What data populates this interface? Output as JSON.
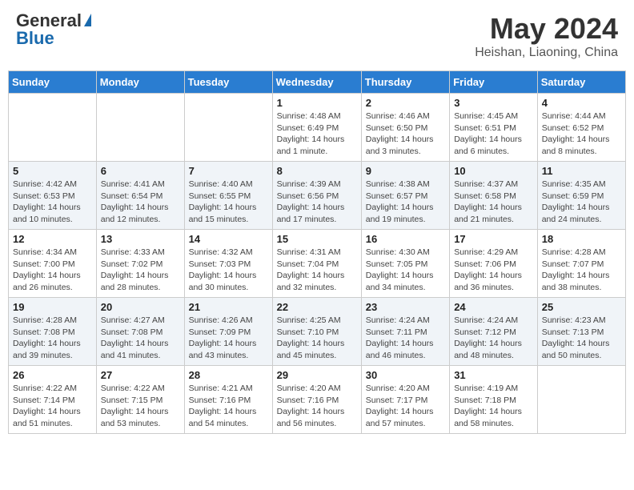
{
  "header": {
    "logo_general": "General",
    "logo_blue": "Blue",
    "title": "May 2024",
    "location": "Heishan, Liaoning, China"
  },
  "days_of_week": [
    "Sunday",
    "Monday",
    "Tuesday",
    "Wednesday",
    "Thursday",
    "Friday",
    "Saturday"
  ],
  "weeks": [
    [
      {
        "day": "",
        "detail": ""
      },
      {
        "day": "",
        "detail": ""
      },
      {
        "day": "",
        "detail": ""
      },
      {
        "day": "1",
        "detail": "Sunrise: 4:48 AM\nSunset: 6:49 PM\nDaylight: 14 hours\nand 1 minute."
      },
      {
        "day": "2",
        "detail": "Sunrise: 4:46 AM\nSunset: 6:50 PM\nDaylight: 14 hours\nand 3 minutes."
      },
      {
        "day": "3",
        "detail": "Sunrise: 4:45 AM\nSunset: 6:51 PM\nDaylight: 14 hours\nand 6 minutes."
      },
      {
        "day": "4",
        "detail": "Sunrise: 4:44 AM\nSunset: 6:52 PM\nDaylight: 14 hours\nand 8 minutes."
      }
    ],
    [
      {
        "day": "5",
        "detail": "Sunrise: 4:42 AM\nSunset: 6:53 PM\nDaylight: 14 hours\nand 10 minutes."
      },
      {
        "day": "6",
        "detail": "Sunrise: 4:41 AM\nSunset: 6:54 PM\nDaylight: 14 hours\nand 12 minutes."
      },
      {
        "day": "7",
        "detail": "Sunrise: 4:40 AM\nSunset: 6:55 PM\nDaylight: 14 hours\nand 15 minutes."
      },
      {
        "day": "8",
        "detail": "Sunrise: 4:39 AM\nSunset: 6:56 PM\nDaylight: 14 hours\nand 17 minutes."
      },
      {
        "day": "9",
        "detail": "Sunrise: 4:38 AM\nSunset: 6:57 PM\nDaylight: 14 hours\nand 19 minutes."
      },
      {
        "day": "10",
        "detail": "Sunrise: 4:37 AM\nSunset: 6:58 PM\nDaylight: 14 hours\nand 21 minutes."
      },
      {
        "day": "11",
        "detail": "Sunrise: 4:35 AM\nSunset: 6:59 PM\nDaylight: 14 hours\nand 24 minutes."
      }
    ],
    [
      {
        "day": "12",
        "detail": "Sunrise: 4:34 AM\nSunset: 7:00 PM\nDaylight: 14 hours\nand 26 minutes."
      },
      {
        "day": "13",
        "detail": "Sunrise: 4:33 AM\nSunset: 7:02 PM\nDaylight: 14 hours\nand 28 minutes."
      },
      {
        "day": "14",
        "detail": "Sunrise: 4:32 AM\nSunset: 7:03 PM\nDaylight: 14 hours\nand 30 minutes."
      },
      {
        "day": "15",
        "detail": "Sunrise: 4:31 AM\nSunset: 7:04 PM\nDaylight: 14 hours\nand 32 minutes."
      },
      {
        "day": "16",
        "detail": "Sunrise: 4:30 AM\nSunset: 7:05 PM\nDaylight: 14 hours\nand 34 minutes."
      },
      {
        "day": "17",
        "detail": "Sunrise: 4:29 AM\nSunset: 7:06 PM\nDaylight: 14 hours\nand 36 minutes."
      },
      {
        "day": "18",
        "detail": "Sunrise: 4:28 AM\nSunset: 7:07 PM\nDaylight: 14 hours\nand 38 minutes."
      }
    ],
    [
      {
        "day": "19",
        "detail": "Sunrise: 4:28 AM\nSunset: 7:08 PM\nDaylight: 14 hours\nand 39 minutes."
      },
      {
        "day": "20",
        "detail": "Sunrise: 4:27 AM\nSunset: 7:08 PM\nDaylight: 14 hours\nand 41 minutes."
      },
      {
        "day": "21",
        "detail": "Sunrise: 4:26 AM\nSunset: 7:09 PM\nDaylight: 14 hours\nand 43 minutes."
      },
      {
        "day": "22",
        "detail": "Sunrise: 4:25 AM\nSunset: 7:10 PM\nDaylight: 14 hours\nand 45 minutes."
      },
      {
        "day": "23",
        "detail": "Sunrise: 4:24 AM\nSunset: 7:11 PM\nDaylight: 14 hours\nand 46 minutes."
      },
      {
        "day": "24",
        "detail": "Sunrise: 4:24 AM\nSunset: 7:12 PM\nDaylight: 14 hours\nand 48 minutes."
      },
      {
        "day": "25",
        "detail": "Sunrise: 4:23 AM\nSunset: 7:13 PM\nDaylight: 14 hours\nand 50 minutes."
      }
    ],
    [
      {
        "day": "26",
        "detail": "Sunrise: 4:22 AM\nSunset: 7:14 PM\nDaylight: 14 hours\nand 51 minutes."
      },
      {
        "day": "27",
        "detail": "Sunrise: 4:22 AM\nSunset: 7:15 PM\nDaylight: 14 hours\nand 53 minutes."
      },
      {
        "day": "28",
        "detail": "Sunrise: 4:21 AM\nSunset: 7:16 PM\nDaylight: 14 hours\nand 54 minutes."
      },
      {
        "day": "29",
        "detail": "Sunrise: 4:20 AM\nSunset: 7:16 PM\nDaylight: 14 hours\nand 56 minutes."
      },
      {
        "day": "30",
        "detail": "Sunrise: 4:20 AM\nSunset: 7:17 PM\nDaylight: 14 hours\nand 57 minutes."
      },
      {
        "day": "31",
        "detail": "Sunrise: 4:19 AM\nSunset: 7:18 PM\nDaylight: 14 hours\nand 58 minutes."
      },
      {
        "day": "",
        "detail": ""
      }
    ]
  ]
}
